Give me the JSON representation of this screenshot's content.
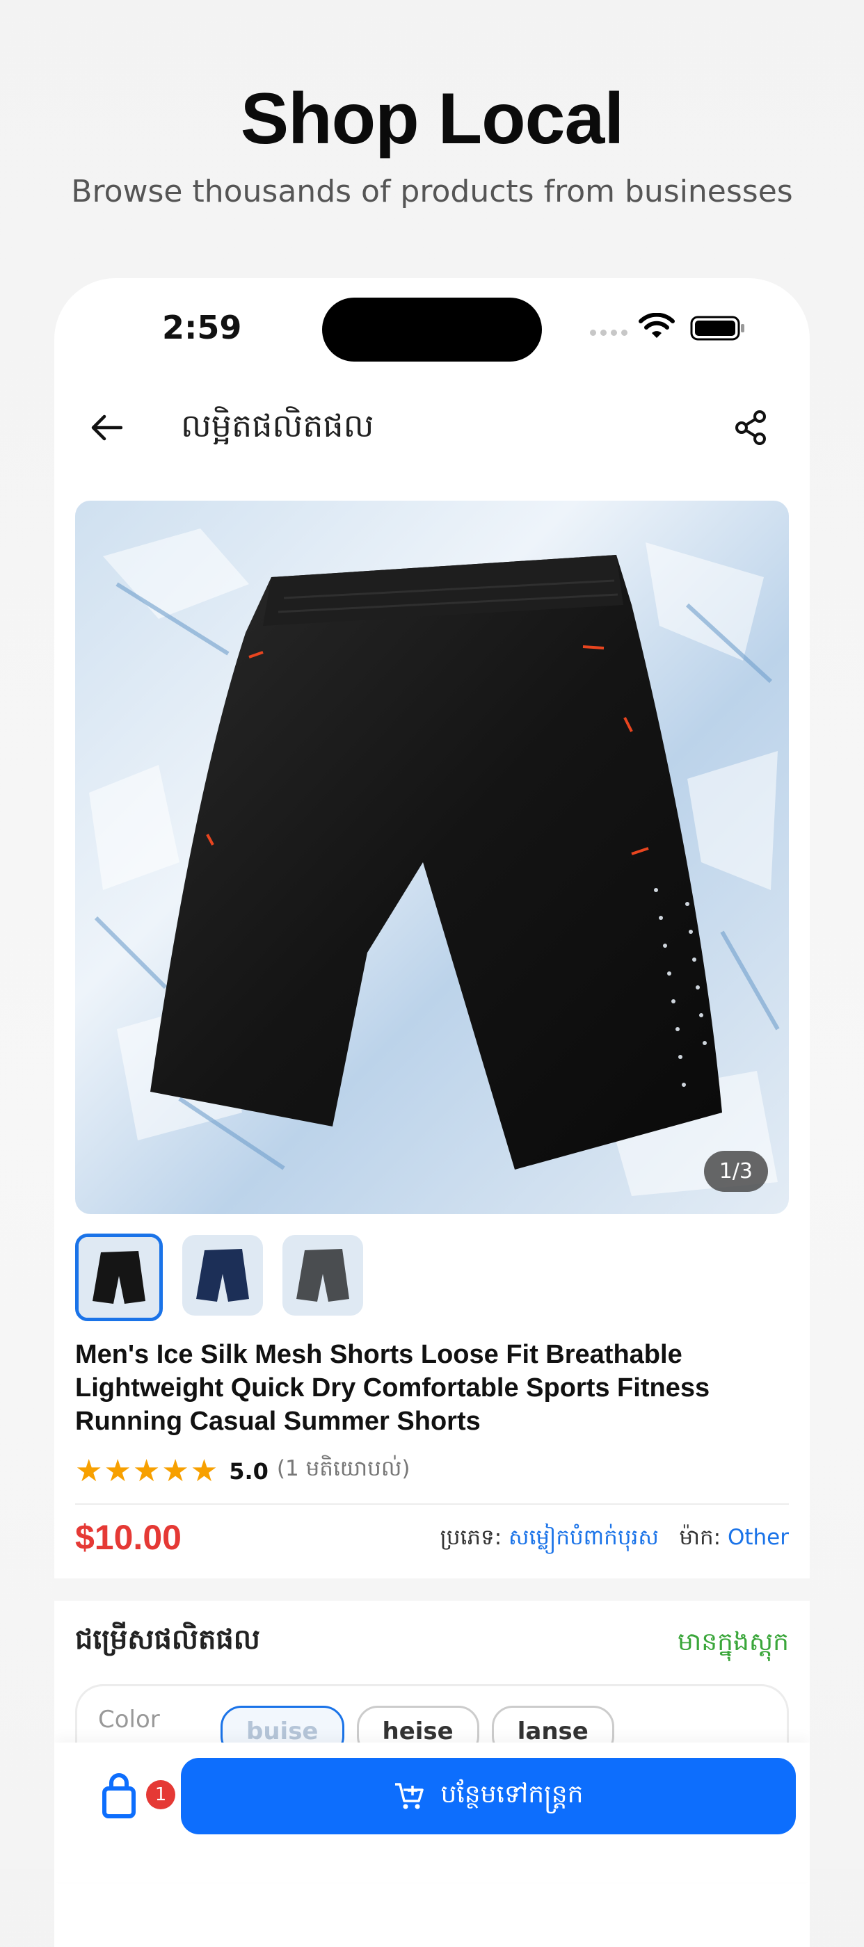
{
  "hero": {
    "title": "Shop Local",
    "subtitle": "Browse thousands of products from businesses"
  },
  "status_bar": {
    "time": "2:59"
  },
  "nav": {
    "title": "លម្អិតផលិតផល",
    "back_icon": "arrow-left-icon",
    "share_icon": "share-icon"
  },
  "gallery": {
    "counter": "1/3",
    "thumbnails": [
      {
        "color": "black",
        "selected": true
      },
      {
        "color": "navy",
        "selected": false
      },
      {
        "color": "gray",
        "selected": false
      }
    ]
  },
  "product": {
    "title": "Men's Ice Silk Mesh Shorts Loose Fit Breathable Lightweight Quick Dry Comfortable Sports Fitness Running Casual Summer Shorts",
    "rating_stars": "★★★★★",
    "rating_value": "5.0",
    "rating_count": "(1 មតិយោបល់)",
    "price": "$10.00",
    "category_label": "ប្រភេទ:",
    "category_value": "សម្លៀកបំពាក់បុរស",
    "brand_label": "ម៉ាក:",
    "brand_value": "Other"
  },
  "options": {
    "title": "ជម្រើសផលិតផល",
    "stock_status": "មានក្នុងស្តុក",
    "color_label": "Color",
    "chips": [
      "buise",
      "heise",
      "lanse"
    ]
  },
  "bottom_bar": {
    "cart_badge": "1",
    "add_to_cart": "បន្ថែមទៅកន្ត្រក"
  },
  "colors": {
    "accent": "#0d6efd",
    "price": "#e53935",
    "stock": "#3aa63a",
    "star": "#f7a000"
  }
}
